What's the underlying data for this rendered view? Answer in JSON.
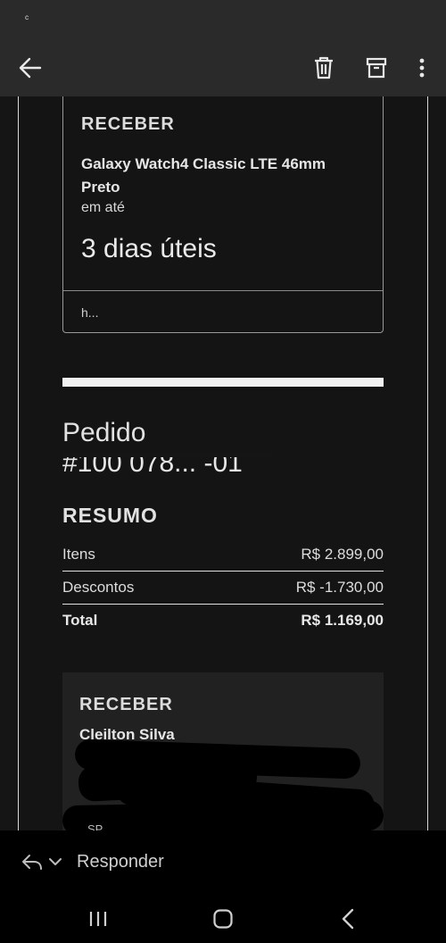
{
  "status_bar": {
    "indicator": "ᶜ"
  },
  "toolbar": {
    "back_icon": "arrow-left-icon",
    "delete_icon": "trash-icon",
    "archive_icon": "archive-icon",
    "more_icon": "more-vertical-icon"
  },
  "delivery_card": {
    "heading": "RECEBER",
    "product": "Galaxy Watch4 Classic LTE 46mm Preto",
    "em_ate": "em até",
    "days": "3 dias úteis",
    "footer_text": "h..."
  },
  "order": {
    "label": "Pedido",
    "number_visible": "#100 078... -01"
  },
  "summary": {
    "heading": "RESUMO",
    "rows": [
      {
        "label": "Itens",
        "value": "R$ 2.899,00"
      },
      {
        "label": "Descontos",
        "value": "R$ -1.730,00"
      },
      {
        "label": "Total",
        "value": "R$ 1.169,00"
      }
    ]
  },
  "recipient_card": {
    "heading": "RECEBER",
    "name": "Cleilton Silva",
    "partial_text": "SP"
  },
  "reply_bar": {
    "reply_icon": "reply-icon",
    "dropdown_icon": "chevron-down-icon",
    "label": "Responder"
  },
  "nav": {
    "recents_icon": "recents-icon",
    "home_icon": "home-icon",
    "back_icon": "nav-back-icon"
  },
  "colors": {
    "background": "#151515",
    "toolbar": "#2a2a2a",
    "card": "#212121",
    "text": "#e6e6e6"
  }
}
